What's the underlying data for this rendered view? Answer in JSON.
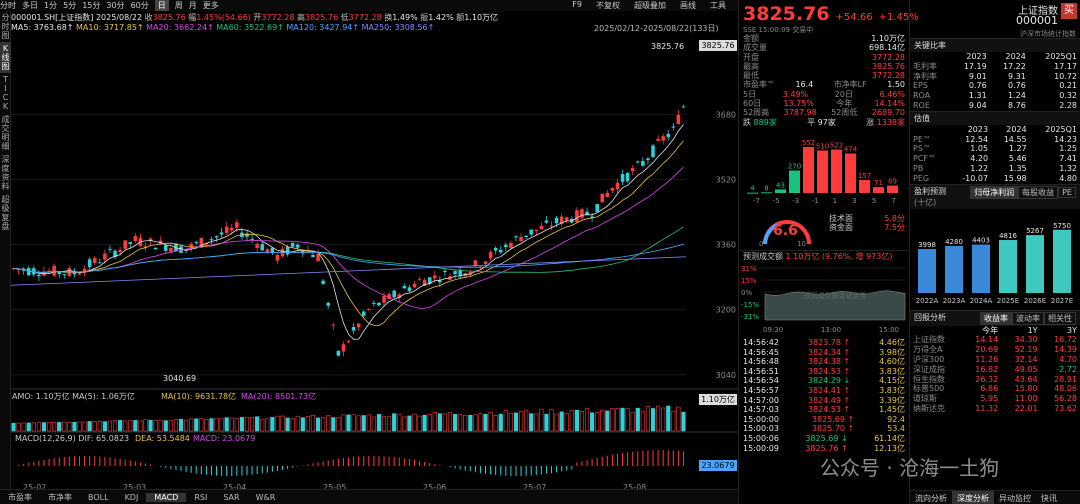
{
  "topbar": {
    "tabs": [
      "分时",
      "多日",
      "1分",
      "5分",
      "15分",
      "30分",
      "60分",
      "日",
      "周",
      "月",
      "更多"
    ],
    "selected": "日",
    "right": [
      "F9",
      "不复权",
      "超级叠加",
      "画线",
      "工具"
    ]
  },
  "lefttabs": [
    "分时图",
    "K线图",
    "TICK",
    "成交明细",
    "深度资料",
    "超级复盘"
  ],
  "chart": {
    "info1": {
      "code": "000001.SH[上证指数]",
      "date": "2025/08/22",
      "close_label": "收",
      "close": "3825.76",
      "change_label": "幅",
      "change": "1.45%(54.66)",
      "open_label": "开",
      "open": "3772.28",
      "high_label": "高",
      "high": "3825.76",
      "low_label": "低",
      "low": "3772.28",
      "turnover_label": "换",
      "turnover": "1.49%",
      "amp_label": "振",
      "amp": "1.42%",
      "vol_label": "额",
      "vol": "1.10万亿"
    },
    "ma": [
      {
        "label": "MA5: 3763.68↑",
        "color": "#e6e6e6"
      },
      {
        "label": "MA10: 3717.85↑",
        "color": "#e8c547"
      },
      {
        "label": "MA20: 3662.24↑",
        "color": "#d946ef"
      },
      {
        "label": "MA60: 3522.69↑",
        "color": "#19c37d"
      },
      {
        "label": "MA120: 3427.94↑",
        "color": "#4ea3ff"
      },
      {
        "label": "MA250: 3308.56↑",
        "color": "#8a8aff"
      }
    ],
    "range": "2025/02/12-2025/08/22(133日)",
    "yticks": [
      "3680",
      "3520",
      "3360",
      "3200",
      "3040"
    ],
    "high_mark": "3825.76",
    "low_mark": "3040.69",
    "price_box": "3825.76",
    "amo_line": "AMO: 1.10万亿  MA(5): 1.06万亿",
    "amo_ma10": "MA(10): 9631.78亿",
    "amo_ma20": "MA(20): 8501.73亿",
    "amo_box": "1.10万亿",
    "macd_line": "MACD(12,26,9)  DIF: 65.0823",
    "macd_dea": "DEA: 53.5484",
    "macd_val": "MACD: 23.0679",
    "macd_box": "23.0679",
    "xticks": [
      "25-02",
      "25-03",
      "25-04",
      "25-05",
      "25-06",
      "25-07",
      "25-08"
    ]
  },
  "bottomtabs": [
    "市盈率",
    "市净率",
    "BOLL",
    "KDJ",
    "MACD",
    "RSI",
    "SAR",
    "W&R"
  ],
  "bottom_selected": "MACD",
  "panel1": {
    "price": "3825.76",
    "chg": "+54.66",
    "pct": "+1.45%",
    "sub": "SSE  15:00:09  交易中",
    "rows": [
      {
        "k": "金额",
        "v": "1.10万亿",
        "c": "white"
      },
      {
        "k": "成交量",
        "v": "698.14亿",
        "c": "white"
      },
      {
        "k": "开盘",
        "v": "3772.28",
        "c": "red"
      },
      {
        "k": "最高",
        "v": "3825.76",
        "c": "red"
      },
      {
        "k": "最低",
        "v": "3772.28",
        "c": "red"
      }
    ],
    "grid": [
      [
        "市盈率™",
        "16.4",
        "市净率LF",
        "1.50"
      ],
      [
        "5日",
        "3.49%",
        "20日",
        "6.46%"
      ],
      [
        "60日",
        "13.75%",
        "今年",
        "14.14%"
      ],
      [
        "52周高",
        "3787.98",
        "52周低",
        "2689.70"
      ]
    ],
    "breadth": {
      "down_label": "跌",
      "down": "889家",
      "flat_label": "平",
      "flat": "97家",
      "up_label": "涨",
      "up": "1338家"
    },
    "dist": {
      "values": [
        4,
        8,
        43,
        270,
        552,
        510,
        522,
        474,
        157,
        71,
        89
      ],
      "labels": [
        "-7",
        "-5",
        "-3",
        "-1",
        "1",
        "3",
        "5",
        "7"
      ]
    },
    "gauge": {
      "value": "6.6",
      "min": "0",
      "max": "10",
      "tech_label": "技术面",
      "tech": "5.8分",
      "fund_label": "资金面",
      "fund": "7.5分"
    },
    "forecast": {
      "title": "预测成交额",
      "val": "1.10万亿",
      "pct": "(9.76%,",
      "inc": "增 973亿)",
      "yticks": [
        "31%",
        "15%",
        "0%",
        "-15%",
        "-31%"
      ],
      "xticks": [
        "09:30",
        "13:00",
        "15:00"
      ],
      "watermark": "预测成交额变化走势"
    },
    "ticks": [
      {
        "t": "14:56:42",
        "p": "3823.78",
        "d": "up",
        "v": "4.46亿"
      },
      {
        "t": "14:56:45",
        "p": "3824.34",
        "d": "up",
        "v": "3.98亿"
      },
      {
        "t": "14:56:48",
        "p": "3824.38",
        "d": "up",
        "v": "4.60亿"
      },
      {
        "t": "14:56:51",
        "p": "3824.53",
        "d": "up",
        "v": "3.83亿"
      },
      {
        "t": "14:56:54",
        "p": "3824.29",
        "d": "down",
        "v": "4.15亿"
      },
      {
        "t": "14:56:57",
        "p": "3824.41",
        "d": "up",
        "v": "3.83亿"
      },
      {
        "t": "14:57:00",
        "p": "3824.49",
        "d": "up",
        "v": "3.39亿"
      },
      {
        "t": "14:57:03",
        "p": "3824.53",
        "d": "up",
        "v": "1.45亿"
      },
      {
        "t": "15:00:00",
        "p": "3825.69",
        "d": "up",
        "v": "92.4"
      },
      {
        "t": "15:00:03",
        "p": "3825.70",
        "d": "up",
        "v": "53.4"
      },
      {
        "t": "15:00:06",
        "p": "3825.69",
        "d": "down",
        "v": "61.14亿"
      },
      {
        "t": "15:00:09",
        "p": "3825.76",
        "d": "up",
        "v": "12.13亿"
      }
    ]
  },
  "panel2": {
    "name": "上证指数",
    "code": "000001",
    "buy": "买",
    "sub": "沪深市场统计指数",
    "kr_title": "关键比率",
    "kr_head": [
      "",
      "2023",
      "2024",
      "2025Q1"
    ],
    "kr_rows": [
      [
        "毛利率",
        "17.19",
        "17.22",
        "17.17"
      ],
      [
        "净利率",
        "9.01",
        "9.31",
        "10.72"
      ],
      [
        "EPS",
        "0.76",
        "0.76",
        "0.21"
      ],
      [
        "ROA",
        "1.31",
        "1.24",
        "0.32"
      ],
      [
        "ROE",
        "9.04",
        "8.76",
        "2.28"
      ]
    ],
    "val_title": "估值",
    "val_head": [
      "",
      "2023",
      "2024",
      "2025Q1"
    ],
    "val_rows": [
      [
        "PE™",
        "12.54",
        "14.55",
        "14.23"
      ],
      [
        "PS™",
        "1.05",
        "1.27",
        "1.25"
      ],
      [
        "PCF™",
        "4.20",
        "5.46",
        "7.41"
      ],
      [
        "PB",
        "1.22",
        "1.35",
        "1.32"
      ],
      [
        "PEG",
        "-10.07",
        "15.98",
        "4.80"
      ]
    ],
    "profit_title": "盈利预测",
    "profit_unit": "(十亿)",
    "profit_tabs": [
      "归母净利润",
      "每股收益",
      "PE"
    ],
    "profit": {
      "categories": [
        "2022A",
        "2023A",
        "2024A",
        "2025E",
        "2026E",
        "2027E"
      ],
      "values": [
        3998,
        4280,
        4403,
        4816,
        5267,
        5750
      ]
    },
    "ra_title": "回报分析",
    "ra_tabs": [
      "收益率",
      "波动率",
      "相关性"
    ],
    "ra_head": [
      "",
      "今年",
      "1Y",
      "3Y"
    ],
    "ra_rows": [
      [
        "上证指数",
        "14.14",
        "34.30",
        "16.72"
      ],
      [
        "万得全A",
        "20.69",
        "52.19",
        "14.39"
      ],
      [
        "沪深300",
        "11.26",
        "32.14",
        "4.70"
      ],
      [
        "深证成指",
        "16.82",
        "49.05",
        "-2.72"
      ],
      [
        "恒生指数",
        "26.32",
        "43.64",
        "28.91"
      ],
      [
        "标普500",
        "6.86",
        "15.80",
        "48.06"
      ],
      [
        "道琼斯",
        "5.95",
        "11.00",
        "56.28"
      ],
      [
        "纳斯达克",
        "11.32",
        "22.01",
        "73.62"
      ]
    ],
    "bottom_tabs": [
      "流向分析",
      "深度分析",
      "异动监控",
      "快讯"
    ],
    "bottom_selected": "深度分析"
  },
  "watermark": "公众号 · 沧海一土狗",
  "colors": {
    "up": "#ff3b3b",
    "down": "#19c37d"
  }
}
